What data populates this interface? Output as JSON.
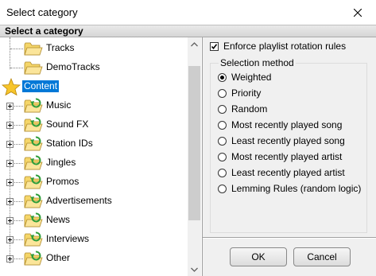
{
  "window": {
    "title": "Select category"
  },
  "header": {
    "text": "Select a category"
  },
  "tree": {
    "items": [
      {
        "label": "Tracks",
        "level": 1,
        "selected": false,
        "icon": "folder-icon"
      },
      {
        "label": "DemoTracks",
        "level": 1,
        "selected": false,
        "icon": "folder-icon"
      },
      {
        "label": "Content",
        "level": 0,
        "selected": true,
        "icon": "star-icon"
      },
      {
        "label": "Music",
        "level": 1,
        "selected": false,
        "icon": "folder-refresh-icon"
      },
      {
        "label": "Sound FX",
        "level": 1,
        "selected": false,
        "icon": "folder-refresh-icon"
      },
      {
        "label": "Station IDs",
        "level": 1,
        "selected": false,
        "icon": "folder-refresh-icon"
      },
      {
        "label": "Jingles",
        "level": 1,
        "selected": false,
        "icon": "folder-refresh-icon"
      },
      {
        "label": "Promos",
        "level": 1,
        "selected": false,
        "icon": "folder-refresh-icon"
      },
      {
        "label": "Advertisements",
        "level": 1,
        "selected": false,
        "icon": "folder-refresh-icon"
      },
      {
        "label": "News",
        "level": 1,
        "selected": false,
        "icon": "folder-refresh-icon"
      },
      {
        "label": "Interviews",
        "level": 1,
        "selected": false,
        "icon": "folder-refresh-icon"
      },
      {
        "label": "Other",
        "level": 1,
        "selected": false,
        "icon": "folder-refresh-icon"
      }
    ]
  },
  "options": {
    "enforce_label": "Enforce playlist rotation rules",
    "enforce_checked": true,
    "selection_group_label": "Selection method",
    "methods": [
      {
        "label": "Weighted",
        "checked": true
      },
      {
        "label": "Priority",
        "checked": false
      },
      {
        "label": "Random",
        "checked": false
      },
      {
        "label": "Most recently played song",
        "checked": false
      },
      {
        "label": "Least recently played song",
        "checked": false
      },
      {
        "label": "Most recently played artist",
        "checked": false
      },
      {
        "label": "Least recently played artist",
        "checked": false
      },
      {
        "label": "Lemming Rules (random logic)",
        "checked": false
      }
    ]
  },
  "buttons": {
    "ok_label": "OK",
    "cancel_label": "Cancel"
  },
  "colors": {
    "selection": "#0078d7",
    "folder": "#f5d66a",
    "arrow": "#2e9e3a",
    "star": "#f7c52b"
  }
}
